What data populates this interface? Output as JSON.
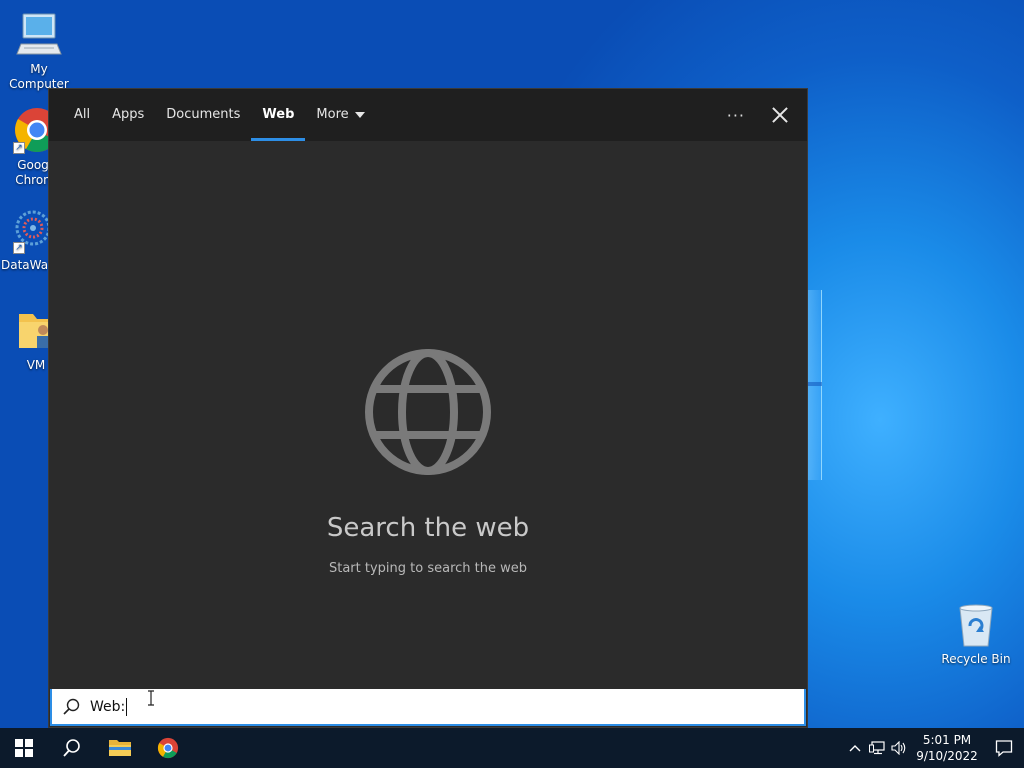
{
  "desktop": {
    "icons": [
      {
        "label": "My Computer"
      },
      {
        "label": "Goog Chron"
      },
      {
        "label": "DataWag"
      },
      {
        "label": "VM"
      }
    ],
    "recycle_bin": "Recycle Bin"
  },
  "search_panel": {
    "tabs": [
      {
        "label": "All"
      },
      {
        "label": "Apps"
      },
      {
        "label": "Documents"
      },
      {
        "label": "Web"
      },
      {
        "label": "More"
      }
    ],
    "active_tab": "Web",
    "more_options": "···",
    "heading": "Search the web",
    "subheading": "Start typing to search the web"
  },
  "searchbox": {
    "prefix": "Web:",
    "value": ""
  },
  "taskbar": {
    "clock_time": "5:01 PM",
    "clock_date": "9/10/2022"
  },
  "colors": {
    "accent": "#2d8ee6",
    "panel_bg": "#2b2b2b",
    "tabbar_bg": "#1f1f1f",
    "taskbar_bg": "#0c1a2b"
  }
}
